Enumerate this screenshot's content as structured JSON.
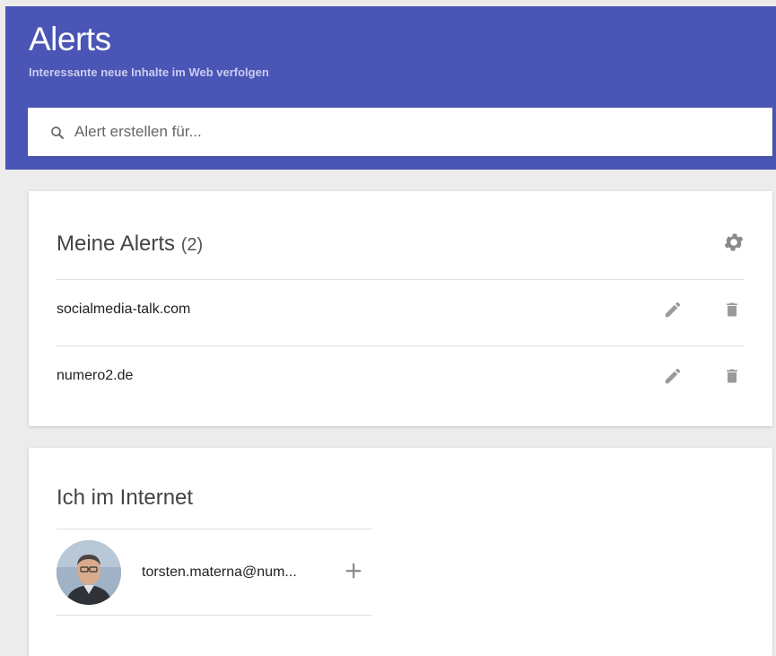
{
  "header": {
    "title": "Alerts",
    "subtitle": "Interessante neue Inhalte im Web verfolgen",
    "background_color": "#4a55b5"
  },
  "search": {
    "placeholder": "Alert erstellen für...",
    "icon": "search-icon"
  },
  "my_alerts": {
    "title": "Meine Alerts",
    "count": "(2)",
    "settings_icon": "gear-icon",
    "items": [
      {
        "label": "socialmedia-talk.com",
        "edit_icon": "pencil-icon",
        "delete_icon": "trash-icon"
      },
      {
        "label": "numero2.de",
        "edit_icon": "pencil-icon",
        "delete_icon": "trash-icon"
      }
    ]
  },
  "me_on_web": {
    "title": "Ich im Internet",
    "email": "torsten.materna@num...",
    "add_icon": "plus-icon"
  }
}
